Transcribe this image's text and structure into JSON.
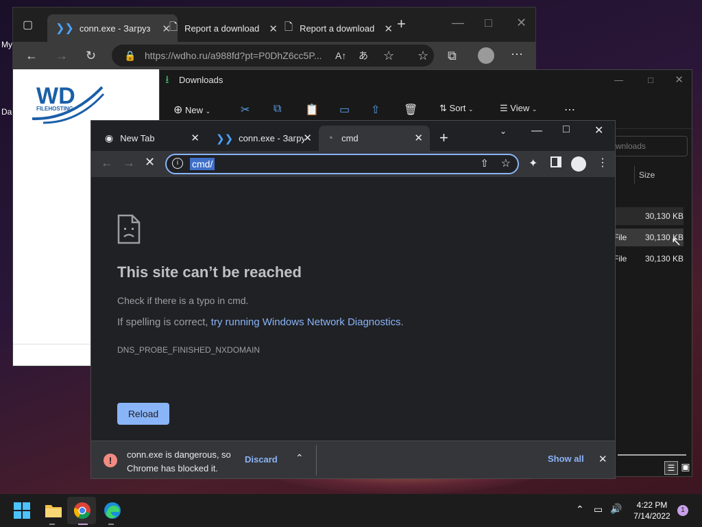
{
  "desktop": {
    "label_1": "My",
    "label_2": "Da"
  },
  "edge": {
    "tabs": [
      {
        "label": "conn.exe - Загрузи"
      },
      {
        "label": "Report a download"
      },
      {
        "label": "Report a download"
      }
    ],
    "url": "https://wdho.ru/a988fd?pt=P0DhZ6cc5P...",
    "logo_text": "WD",
    "logo_sub": "FILEHOSTING"
  },
  "explorer": {
    "title": "Downloads",
    "toolbar": {
      "new": "New",
      "sort": "Sort",
      "view": "View"
    },
    "search_placeholder": "wnloads",
    "column_size": "Size",
    "rows": [
      {
        "type": "",
        "size": "30,130 KB"
      },
      {
        "type": "File",
        "size": "30,130 KB"
      },
      {
        "type": "File",
        "size": "30,130 KB"
      }
    ]
  },
  "chrome": {
    "tabs": [
      {
        "label": "New Tab"
      },
      {
        "label": "conn.exe - Загрузи"
      },
      {
        "label": "cmd"
      }
    ],
    "omnibox": "cmd/",
    "error": {
      "title": "This site can’t be reached",
      "line1": "Check if there is a typo in cmd.",
      "line2_prefix": "If spelling is correct, ",
      "line2_link": "try running Windows Network Diagnostics",
      "line2_suffix": ".",
      "code": "DNS_PROBE_FINISHED_NXDOMAIN",
      "reload": "Reload"
    },
    "download": {
      "message_line1": "conn.exe is dangerous, so",
      "message_line2": "Chrome has blocked it.",
      "discard": "Discard",
      "show_all": "Show all"
    }
  },
  "taskbar": {
    "time": "4:22 PM",
    "date": "7/14/2022",
    "notification_count": "1"
  }
}
